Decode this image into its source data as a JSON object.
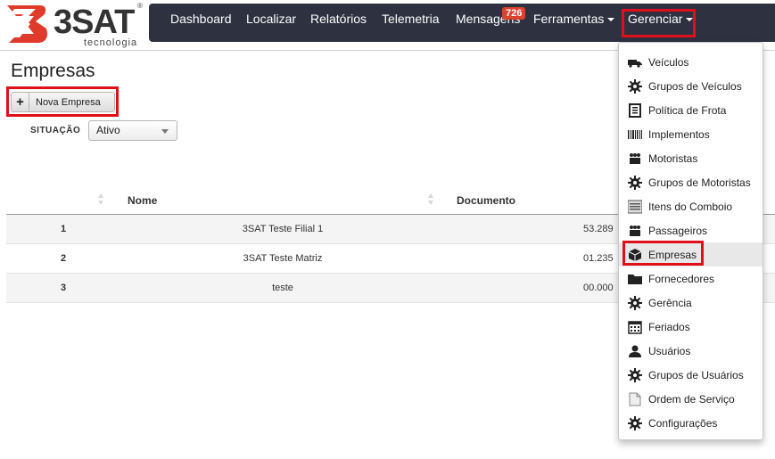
{
  "logo": {
    "name": "3SAT",
    "sub": "tecnologia",
    "reg": "®"
  },
  "nav": {
    "items": [
      {
        "label": "Dashboard"
      },
      {
        "label": "Localizar"
      },
      {
        "label": "Relatórios"
      },
      {
        "label": "Telemetria"
      },
      {
        "label": "Mensagens",
        "badge": "726"
      },
      {
        "label": "Ferramentas"
      },
      {
        "label": "Gerenciar"
      }
    ]
  },
  "page": {
    "title": "Empresas",
    "new_button": "Nova Empresa",
    "situacao_label": "SITUAÇÃO",
    "situacao_value": "Ativo"
  },
  "table": {
    "columns": [
      "Nome",
      "Documento"
    ],
    "rows": [
      {
        "id": "1",
        "nome": "3SAT Teste Filial 1",
        "doc": "53.289"
      },
      {
        "id": "2",
        "nome": "3SAT Teste Matriz",
        "doc": "01.235"
      },
      {
        "id": "3",
        "nome": "teste",
        "doc": "00.000"
      }
    ]
  },
  "menu": {
    "items": [
      {
        "label": "Veículos",
        "icon": "truck-icon"
      },
      {
        "label": "Grupos de Veículos",
        "icon": "gear-icon"
      },
      {
        "label": "Política de Frota",
        "icon": "document-icon"
      },
      {
        "label": "Implementos",
        "icon": "barcode-icon"
      },
      {
        "label": "Motoristas",
        "icon": "people-icon"
      },
      {
        "label": "Grupos de Motoristas",
        "icon": "gear-icon"
      },
      {
        "label": "Itens do Comboio",
        "icon": "list-icon"
      },
      {
        "label": "Passageiros",
        "icon": "people-icon"
      },
      {
        "label": "Empresas",
        "icon": "box-icon",
        "active": true
      },
      {
        "label": "Fornecedores",
        "icon": "folder-icon"
      },
      {
        "label": "Gerência",
        "icon": "gear-icon"
      },
      {
        "label": "Feriados",
        "icon": "calendar-icon"
      },
      {
        "label": "Usuários",
        "icon": "user-icon"
      },
      {
        "label": "Grupos de Usuários",
        "icon": "gear-icon"
      },
      {
        "label": "Ordem de Serviço",
        "icon": "page-icon"
      },
      {
        "label": "Configurações",
        "icon": "gear-icon"
      }
    ]
  },
  "colors": {
    "navbar": "#2e3140",
    "highlight": "#e0101a",
    "logo_red": "#e03a2a",
    "badge": "#d9432e"
  }
}
